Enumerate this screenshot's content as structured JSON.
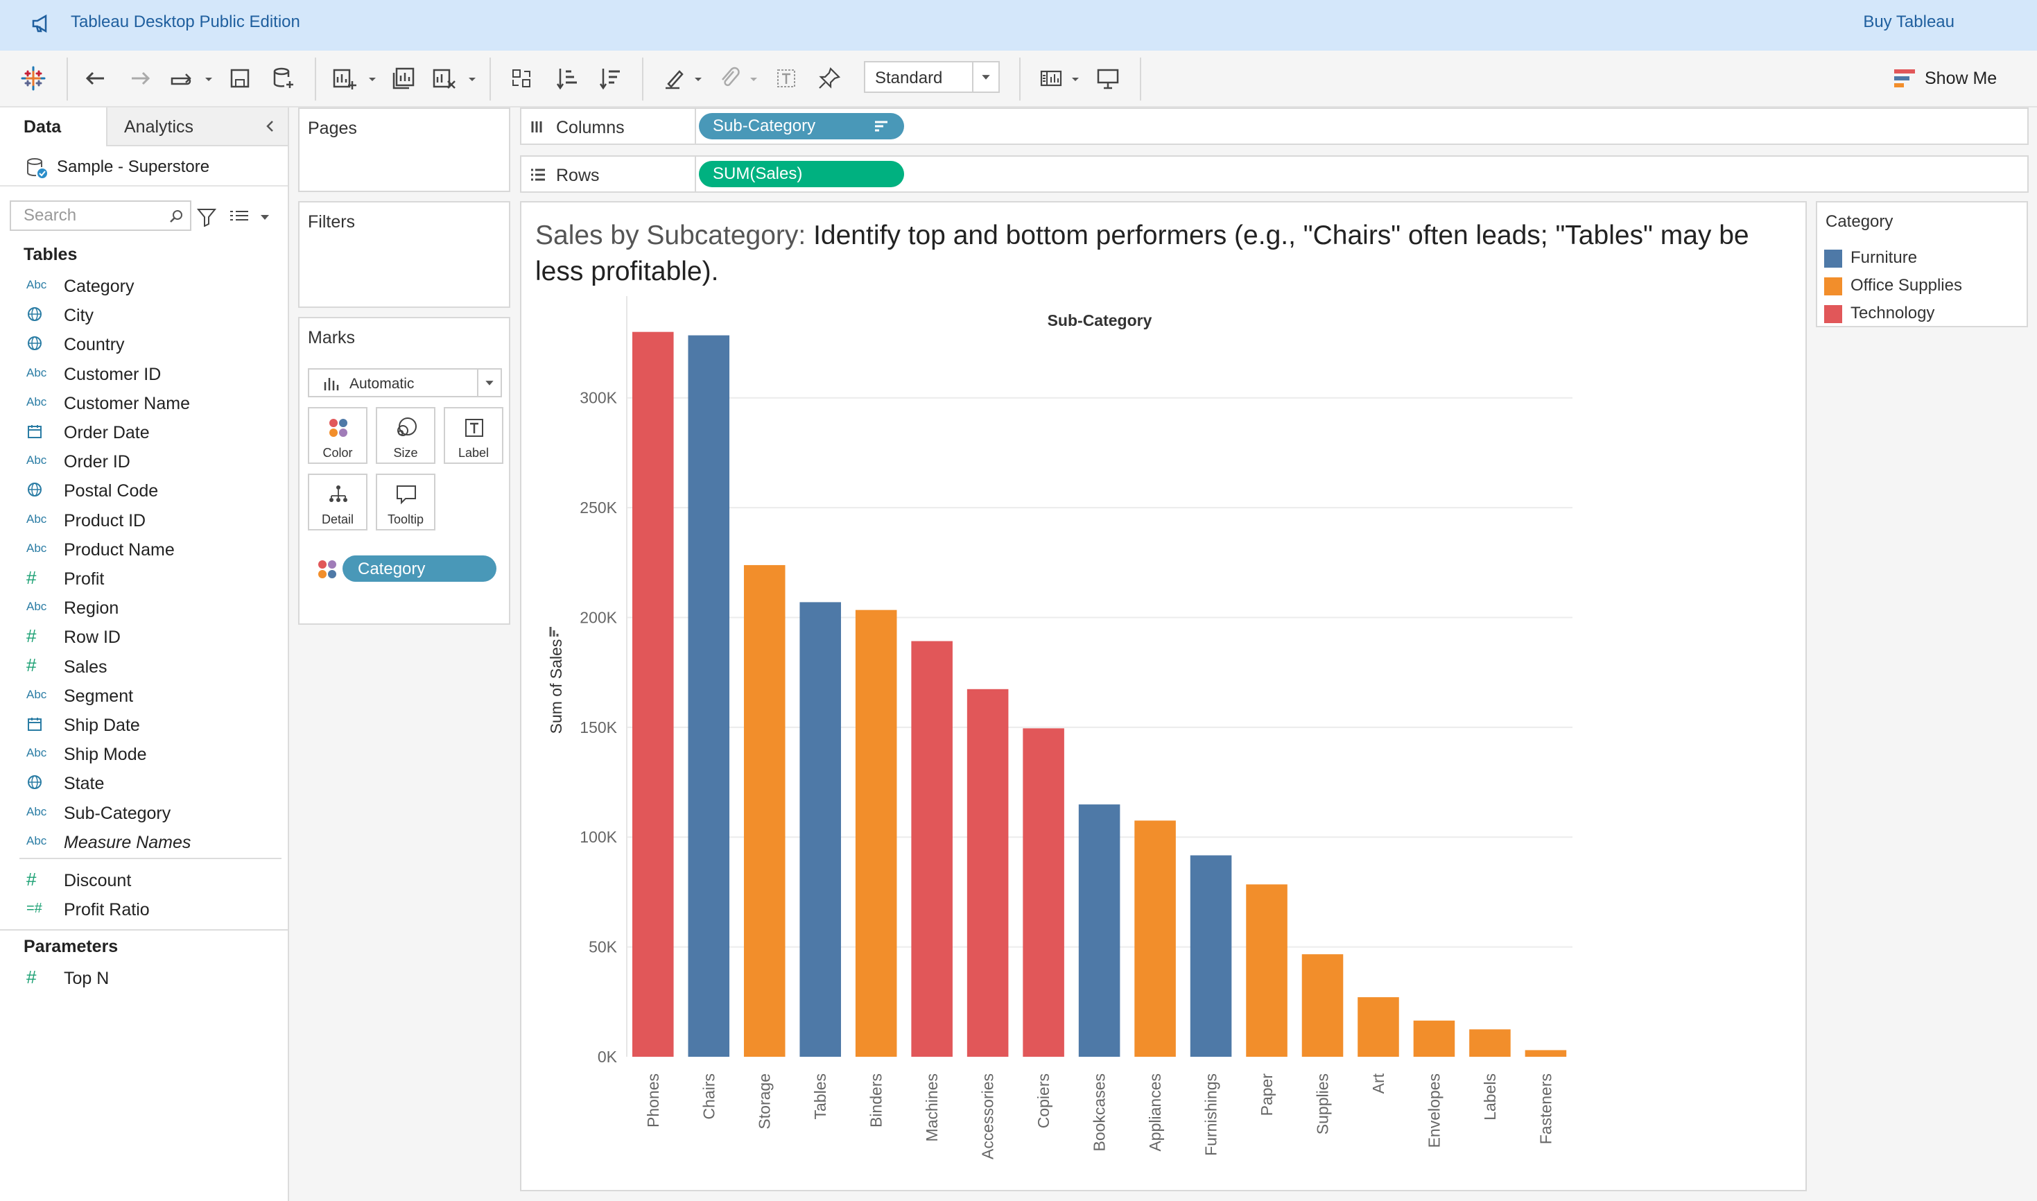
{
  "app": {
    "title": "Tableau Desktop Public Edition",
    "buy_label": "Buy Tableau"
  },
  "toolbar": {
    "fit_value": "Standard",
    "show_me_label": "Show Me"
  },
  "data_pane": {
    "tabs": [
      {
        "label": "Data"
      },
      {
        "label": "Analytics"
      }
    ],
    "datasource": "Sample - Superstore",
    "search_placeholder": "Search",
    "tables_heading": "Tables",
    "fields": [
      {
        "type": "Abc",
        "name": "Category"
      },
      {
        "type": "globe",
        "name": "City"
      },
      {
        "type": "globe",
        "name": "Country"
      },
      {
        "type": "Abc",
        "name": "Customer ID"
      },
      {
        "type": "Abc",
        "name": "Customer Name"
      },
      {
        "type": "calendar",
        "name": "Order Date"
      },
      {
        "type": "Abc",
        "name": "Order ID"
      },
      {
        "type": "globe",
        "name": "Postal Code"
      },
      {
        "type": "Abc",
        "name": "Product ID"
      },
      {
        "type": "Abc",
        "name": "Product Name"
      },
      {
        "type": "#",
        "name": "Profit"
      },
      {
        "type": "Abc",
        "name": "Region"
      },
      {
        "type": "#",
        "name": "Row ID"
      },
      {
        "type": "#",
        "name": "Sales"
      },
      {
        "type": "Abc",
        "name": "Segment"
      },
      {
        "type": "calendar",
        "name": "Ship Date"
      },
      {
        "type": "Abc",
        "name": "Ship Mode"
      },
      {
        "type": "globe",
        "name": "State"
      },
      {
        "type": "Abc",
        "name": "Sub-Category"
      },
      {
        "type": "Abc",
        "name": "Measure Names",
        "italic": true
      }
    ],
    "measures": [
      {
        "type": "#",
        "name": "Discount"
      },
      {
        "type": "=#",
        "name": "Profit Ratio"
      }
    ],
    "parameters_heading": "Parameters",
    "parameters": [
      {
        "type": "#",
        "name": "Top N"
      }
    ]
  },
  "cards": {
    "pages_label": "Pages",
    "filters_label": "Filters",
    "marks_label": "Marks",
    "mark_type": "Automatic",
    "mark_buttons": [
      {
        "label": "Color",
        "icon": "color-icon"
      },
      {
        "label": "Size",
        "icon": "size-icon"
      },
      {
        "label": "Label",
        "icon": "label-icon"
      },
      {
        "label": "Detail",
        "icon": "detail-icon"
      },
      {
        "label": "Tooltip",
        "icon": "tooltip-icon"
      }
    ],
    "color_pill": "Category"
  },
  "shelves": {
    "columns_label": "Columns",
    "columns_pill": "Sub-Category",
    "rows_label": "Rows",
    "rows_pill": "SUM(Sales)",
    "columns_pill_color": "#4998b8",
    "rows_pill_color": "#00b180"
  },
  "viz": {
    "title_part1": "Sales by Subcategory: ",
    "title_part2": "Identify top and bottom performers (e.g., \"Chairs\" often leads; \"Tables\" may be less profitable)."
  },
  "legend": {
    "title": "Category",
    "items": [
      {
        "name": "Furniture",
        "color": "#4e79a7"
      },
      {
        "name": "Office Supplies",
        "color": "#f28e2b"
      },
      {
        "name": "Technology",
        "color": "#e15759"
      }
    ]
  },
  "chart_data": {
    "type": "bar",
    "title": "Sub-Category",
    "xlabel": "Sub-Category",
    "ylabel": "Sum of Sales",
    "ylim": [
      0,
      340000
    ],
    "yticks": [
      0,
      50000,
      100000,
      150000,
      200000,
      250000,
      300000
    ],
    "ytick_labels": [
      "0K",
      "50K",
      "100K",
      "150K",
      "200K",
      "250K",
      "300K"
    ],
    "grid": true,
    "categories": [
      "Phones",
      "Chairs",
      "Storage",
      "Tables",
      "Binders",
      "Machines",
      "Accessories",
      "Copiers",
      "Bookcases",
      "Appliances",
      "Furnishings",
      "Paper",
      "Supplies",
      "Art",
      "Envelopes",
      "Labels",
      "Fasteners"
    ],
    "values": [
      330007,
      328449,
      223844,
      206966,
      203413,
      189239,
      167380,
      149528,
      114880,
      107532,
      91705,
      78479,
      46674,
      27119,
      16476,
      12486,
      3024
    ],
    "category_group": [
      "Technology",
      "Furniture",
      "Office Supplies",
      "Furniture",
      "Office Supplies",
      "Technology",
      "Technology",
      "Technology",
      "Furniture",
      "Office Supplies",
      "Furniture",
      "Office Supplies",
      "Office Supplies",
      "Office Supplies",
      "Office Supplies",
      "Office Supplies",
      "Office Supplies"
    ],
    "colors": {
      "Furniture": "#4e79a7",
      "Office Supplies": "#f28e2b",
      "Technology": "#e15759"
    }
  }
}
